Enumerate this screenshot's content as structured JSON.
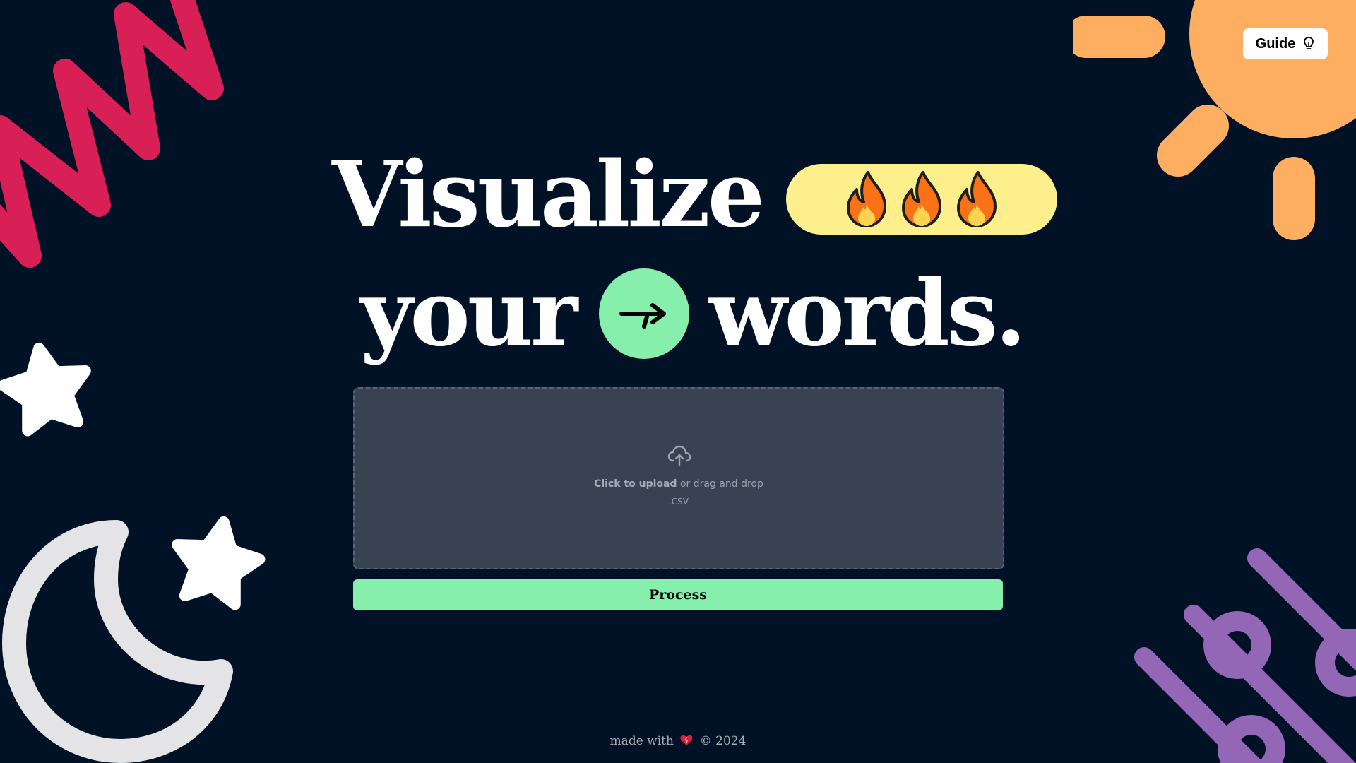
{
  "header": {
    "guide_label": "Guide",
    "guide_icon": "lightbulb-icon"
  },
  "hero": {
    "line1_word": "Visualize",
    "line2_word1": "your",
    "line2_word2": "words.",
    "fire_icons": [
      "fire-icon",
      "fire-icon",
      "fire-icon"
    ],
    "arrow_icon": "arrow-right-icon"
  },
  "upload": {
    "icon": "cloud-upload-icon",
    "click_label": "Click to upload",
    "drag_text": " or drag and drop",
    "hint": ".CSV",
    "accept": ".csv"
  },
  "actions": {
    "process_label": "Process"
  },
  "footer": {
    "made_with": "made with",
    "heart_icon": "heart-icon",
    "copyright": "© 2024"
  },
  "colors": {
    "background": "#021226",
    "accent_green": "#86efac",
    "fire_pill": "#fdf08c",
    "zigzag": "#d81f56",
    "sun": "#fdae61",
    "sliders": "#9366b6",
    "moon": "#e4e4e7",
    "dropzone": "#394253"
  }
}
